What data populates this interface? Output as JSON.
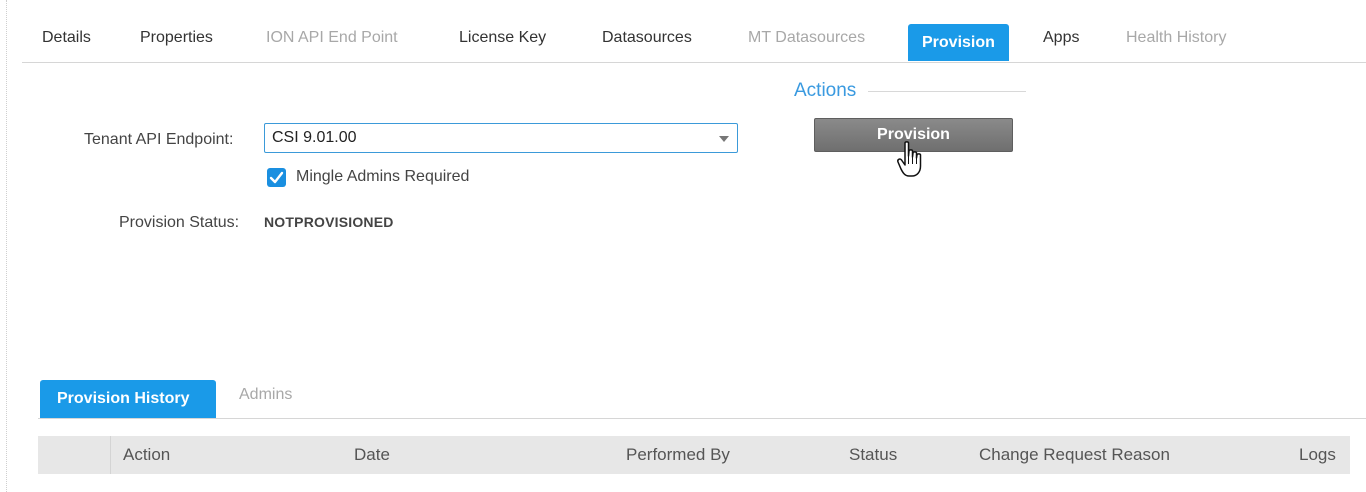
{
  "top_tabs": [
    {
      "label": "Details",
      "state": "normal"
    },
    {
      "label": "Properties",
      "state": "normal"
    },
    {
      "label": "ION API End Point",
      "state": "disabled"
    },
    {
      "label": "License Key",
      "state": "normal"
    },
    {
      "label": "Datasources",
      "state": "normal"
    },
    {
      "label": "MT Datasources",
      "state": "disabled"
    },
    {
      "label": "Provision",
      "state": "active"
    },
    {
      "label": "Apps",
      "state": "normal"
    },
    {
      "label": "Health History",
      "state": "disabled"
    }
  ],
  "form": {
    "endpoint_label": "Tenant API Endpoint:",
    "endpoint_value": "CSI 9.01.00",
    "mingle_checked": true,
    "mingle_label": "Mingle Admins Required",
    "status_label": "Provision Status:",
    "status_value": "NOTPROVISIONED"
  },
  "actions": {
    "title": "Actions",
    "provision_button": "Provision"
  },
  "bottom_tabs": [
    {
      "label": "Provision History",
      "state": "active"
    },
    {
      "label": "Admins",
      "state": "inactive"
    }
  ],
  "table": {
    "columns": [
      "Action",
      "Date",
      "Performed By",
      "Status",
      "Change Request Reason",
      "Logs"
    ]
  },
  "colors": {
    "accent": "#1a9ae8",
    "button_gray": "#7a7a7a"
  },
  "icons": {
    "dropdown": "chevron-down-icon",
    "checkbox": "check-icon",
    "cursor": "hand-pointer-icon"
  }
}
